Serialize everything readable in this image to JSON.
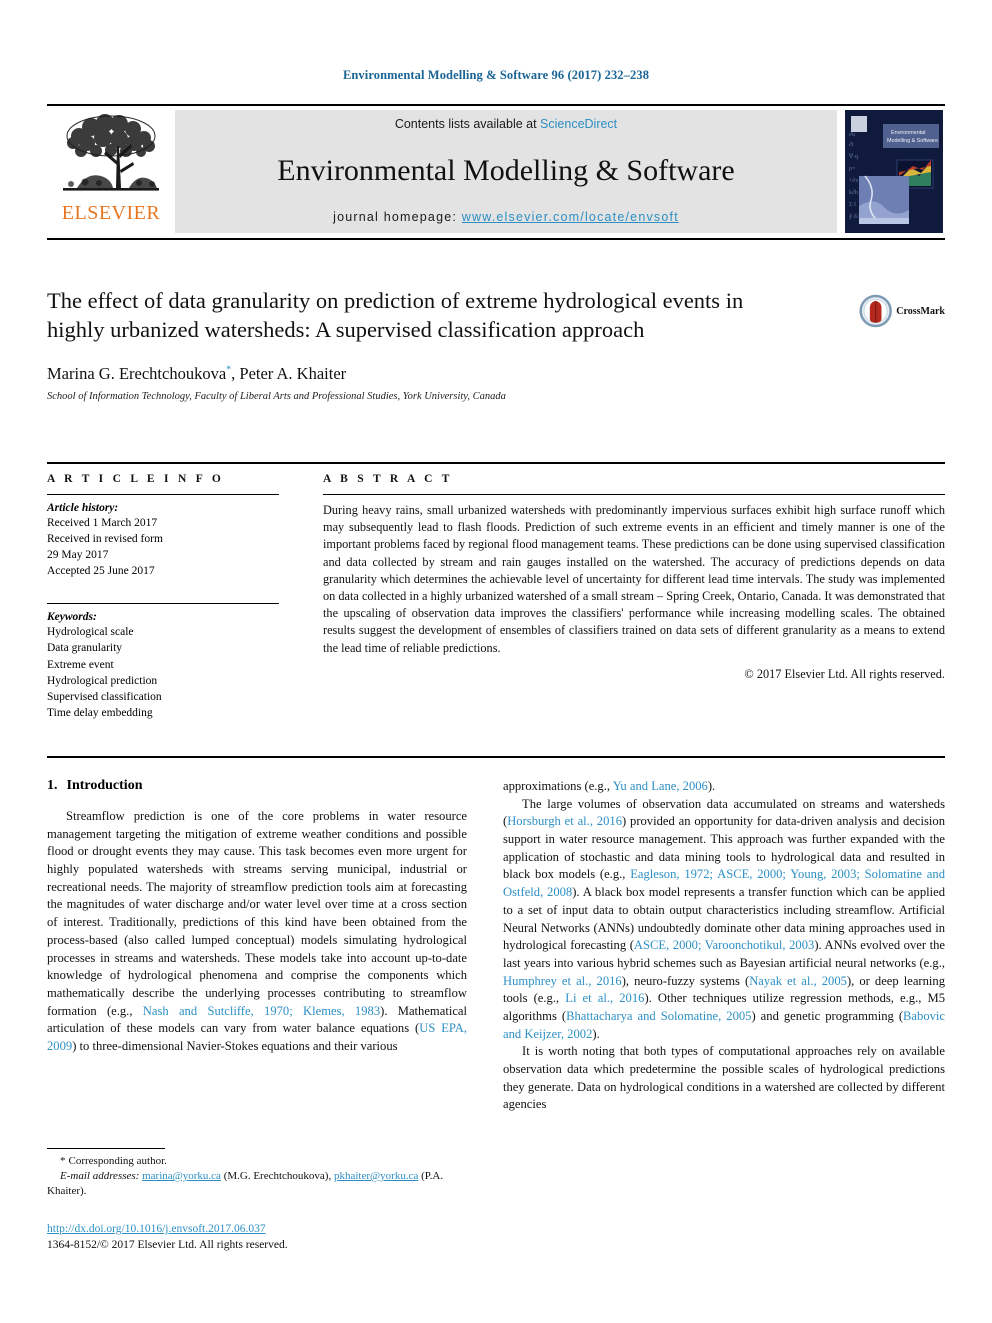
{
  "running_head": "Environmental Modelling & Software 96 (2017) 232–238",
  "masthead": {
    "publisher_name": "ELSEVIER",
    "logo_alt": "elsevier-tree-logo",
    "contents_prefix": "Contents lists available at ",
    "contents_link": "ScienceDirect",
    "journal_title": "Environmental Modelling & Software",
    "homepage_prefix": "journal homepage: ",
    "homepage_url": "www.elsevier.com/locate/envsoft",
    "cover_title_line1": "Environmental",
    "cover_title_line2": "Modelling & Software"
  },
  "article": {
    "title": "The effect of data granularity on prediction of extreme hydrological events in highly urbanized watersheds: A supervised classification approach",
    "authors": "Marina G. Erechtchoukova",
    "author_marker": "*",
    "authors_rest": ", Peter A. Khaiter",
    "affiliation": "School of Information Technology, Faculty of Liberal Arts and Professional Studies, York University, Canada",
    "crossmark_label": "CrossMark"
  },
  "info": {
    "heading": "A R T I C L E    I N F O",
    "history_title": "Article history:",
    "history_lines": [
      "Received 1 March 2017",
      "Received in revised form",
      "29 May 2017",
      "Accepted 25 June 2017"
    ],
    "keywords_title": "Keywords:",
    "keywords": [
      "Hydrological scale",
      "Data granularity",
      "Extreme event",
      "Hydrological prediction",
      "Supervised classification",
      "Time delay embedding"
    ]
  },
  "abstract": {
    "heading": "A B S T R A C T",
    "text": "During heavy rains, small urbanized watersheds with predominantly impervious surfaces exhibit high surface runoff which may subsequently lead to flash floods. Prediction of such extreme events in an efficient and timely manner is one of the important problems faced by regional flood management teams. These predictions can be done using supervised classification and data collected by stream and rain gauges installed on the watershed. The accuracy of predictions depends on data granularity which determines the achievable level of uncertainty for different lead time intervals. The study was implemented on data collected in a highly urbanized watershed of a small stream – Spring Creek, Ontario, Canada. It was demonstrated that the upscaling of observation data improves the classifiers' performance while increasing modelling scales. The obtained results suggest the development of ensembles of classifiers trained on data sets of different granularity as a means to extend the lead time of reliable predictions.",
    "copyright": "© 2017 Elsevier Ltd. All rights reserved."
  },
  "body": {
    "section_number": "1.",
    "section_title": "Introduction",
    "left_p1_a": "Streamflow prediction is one of the core problems in water resource management targeting the mitigation of extreme weather conditions and possible flood or drought events they may cause. This task becomes even more urgent for highly populated watersheds with streams serving municipal, industrial or recreational needs. The majority of streamflow prediction tools aim at forecasting the magnitudes of water discharge and/or water level over time at a cross section of interest. Traditionally, predictions of this kind have been obtained from the process-based (also called lumped conceptual) models simulating hydrological processes in streams and watersheds. These models take into account up-to-date knowledge of hydrological phenomena and comprise the components which mathematically describe the underlying processes contributing to streamflow formation (e.g., ",
    "left_cite1": "Nash and Sutcliffe, 1970; Klemes, 1983",
    "left_p1_b": "). Mathematical articulation of these models can vary from water balance equations (",
    "left_cite2": "US EPA, 2009",
    "left_p1_c": ") to three-dimensional Navier-Stokes equations and their various ",
    "right_p1_a": "approximations (e.g., ",
    "right_cite1": "Yu and Lane, 2006",
    "right_p1_b": ").",
    "right_p2_a": "The large volumes of observation data accumulated on streams and watersheds (",
    "right_cite2": "Horsburgh et al., 2016",
    "right_p2_b": ") provided an opportunity for data-driven analysis and decision support in water resource management. This approach was further expanded with the application of stochastic and data mining tools to hydrological data and resulted in black box models (e.g., ",
    "right_cite3": "Eagleson, 1972; ASCE, 2000; Young, 2003; Solomatine and Ostfeld, 2008",
    "right_p2_c": "). A black box model represents a transfer function which can be applied to a set of input data to obtain output characteristics including streamflow. Artificial Neural Networks (ANNs) undoubtedly dominate other data mining approaches used in hydrological forecasting (",
    "right_cite4": "ASCE, 2000; Varoonchotikul, 2003",
    "right_p2_d": "). ANNs evolved over the last years into various hybrid schemes such as Bayesian artificial neural networks (e.g., ",
    "right_cite5": "Humphrey et al., 2016",
    "right_p2_e": "), neuro-fuzzy systems (",
    "right_cite6": "Nayak et al., 2005",
    "right_p2_f": "), or deep learning tools (e.g., ",
    "right_cite7": "Li et al., 2016",
    "right_p2_g": "). Other techniques utilize regression methods, e.g., M5 algorithms (",
    "right_cite8": "Bhattacharya and Solomatine, 2005",
    "right_p2_h": ") and genetic programming (",
    "right_cite9": "Babovic and Keijzer, 2002",
    "right_p2_i": ").",
    "right_p3": "It is worth noting that both types of computational approaches rely on available observation data which predetermine the possible scales of hydrological predictions they generate. Data on hydrological conditions in a watershed are collected by different agencies"
  },
  "footnotes": {
    "corresponding_star": "*",
    "corresponding_text": "Corresponding author.",
    "email_label": "E-mail addresses:",
    "email1": "marina@yorku.ca",
    "email1_owner": "(M.G. Erechtchoukova),",
    "email2": "pkhaiter@yorku.ca",
    "email2_owner": "(P.A. Khaiter).",
    "doi": "http://dx.doi.org/10.1016/j.envsoft.2017.06.037",
    "issn": "1364-8152/© 2017 Elsevier Ltd. All rights reserved."
  },
  "colors": {
    "link_blue": "#2d8fc4",
    "running_head_blue": "#1a6496",
    "elsevier_orange": "#E87722",
    "band_grey": "#e3e3e3",
    "cover_navy": "#101a3c"
  }
}
